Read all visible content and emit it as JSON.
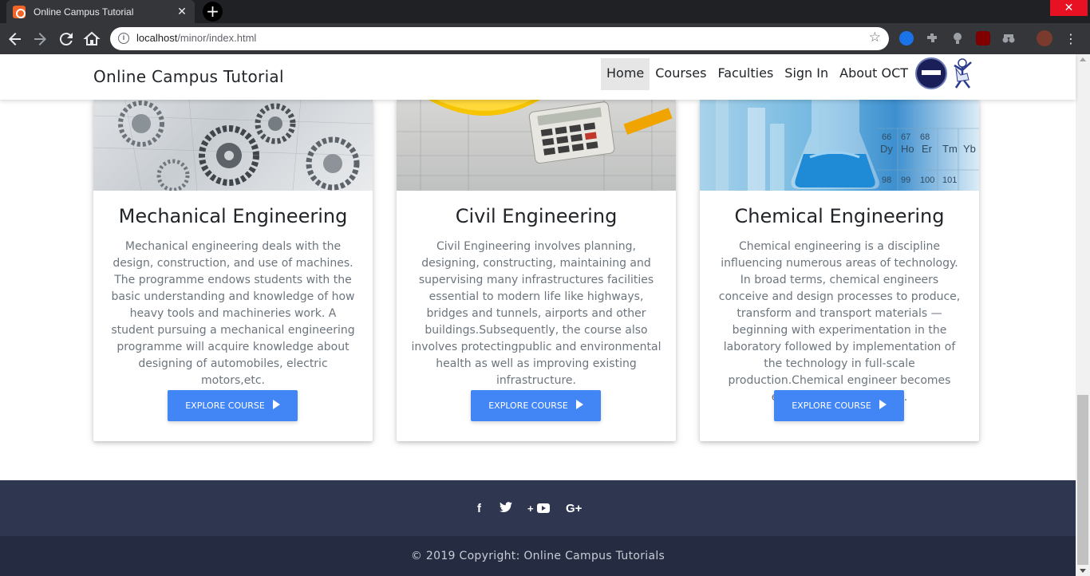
{
  "browser": {
    "tab_title": "Online Campus Tutorial",
    "url_host": "localhost",
    "url_path": "/minor/index.html",
    "close_glyph": "✕",
    "newtab_glyph": "+"
  },
  "nav": {
    "brand": "Online Campus Tutorial",
    "items": [
      "Home",
      "Courses",
      "Faculties",
      "Sign In",
      "About OCT"
    ],
    "active": "Home"
  },
  "courses": [
    {
      "title": "Mechanical Engineering",
      "description": "Mechanical engineering deals with the design, construction, and use of machines. The programme endows students with the basic understanding and knowledge of how heavy tools and machineries work. A student pursuing a mechanical engineering programme will acquire knowledge about designing of automobiles, electric motors,etc.",
      "button": "EXPLORE COURSE"
    },
    {
      "title": "Civil Engineering",
      "description": "Civil Engineering involves planning, designing, constructing, maintaining and supervising many infrastructures facilities essential to modern life like highways, bridges and tunnels, airports and other buildings.Subsequently, the course also involves protectingpublic and environmental health as well as improving existing infrastructure.",
      "button": "EXPLORE COURSE"
    },
    {
      "title": "Chemical Engineering",
      "description": "Chemical engineering is a discipline influencing numerous areas of technology. In broad terms, chemical engineers conceive and design processes to produce, transform and transport materials — beginning with experimentation in the laboratory followed by implementation of the technology in full-scale production.Chemical engineer becomes essential in these areas.",
      "button": "EXPLORE COURSE"
    }
  ],
  "footer": {
    "social": [
      "f",
      "🐦",
      "+▶",
      "G+"
    ],
    "social_icons": [
      "facebook-icon",
      "twitter-icon",
      "youtube-icon",
      "google-plus-icon"
    ],
    "copyright": "© 2019 Copyright: Online Campus Tutorials"
  },
  "colors": {
    "accent": "#4285f4",
    "footer_top": "#2e3650",
    "footer_bottom": "#252c41"
  }
}
